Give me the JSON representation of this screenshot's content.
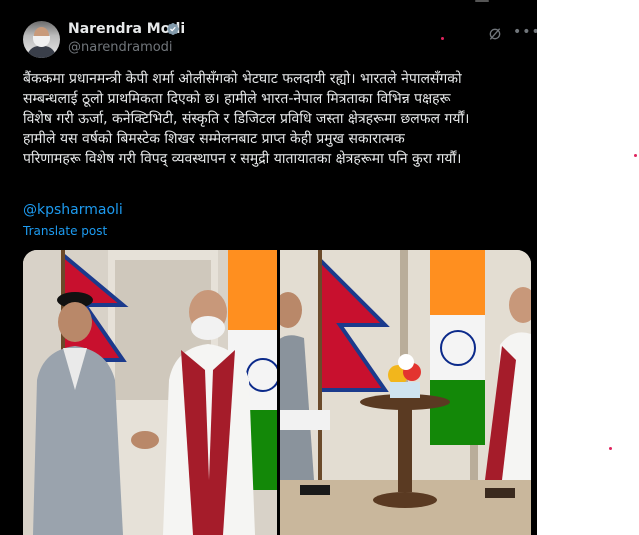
{
  "author": {
    "name": "Narendra Modi",
    "handle": "@narendramodi",
    "verified": true
  },
  "post": {
    "text": "बैंककमा प्रधानमन्त्री केपी शर्मा ओलीसँगको भेटघाट फलदायी रह्यो। भारतले नेपालसँगको\nसम्बन्धलाई ठूलो प्राथमिकता दिएको छ। हामीले भारत-नेपाल मित्रताका विभिन्न पक्षहरू\nविशेष गरी ऊर्जा, कनेक्टिभिटी, संस्कृति र डिजिटल प्रविधि जस्ता क्षेत्रहरूमा छलफल गर्यौं।\nहामीले यस वर्षको बिमस्टेक शिखर सम्मेलनबाट प्राप्त केही प्रमुख सकारात्मक\nपरिणामहरू विशेष गरी विपद् व्यवस्थापन र समुद्री यातायातका क्षेत्रहरूमा पनि कुरा गर्यौं।",
    "mention": "@kpsharmaoli",
    "translate_label": "Translate post"
  },
  "icons": {
    "verified": "verified-badge-icon",
    "grok": "grok-icon",
    "more": "more-icon"
  },
  "colors": {
    "background": "#000000",
    "text": "#e7e9ea",
    "secondary": "#71767b",
    "link": "#1d9bf0"
  }
}
